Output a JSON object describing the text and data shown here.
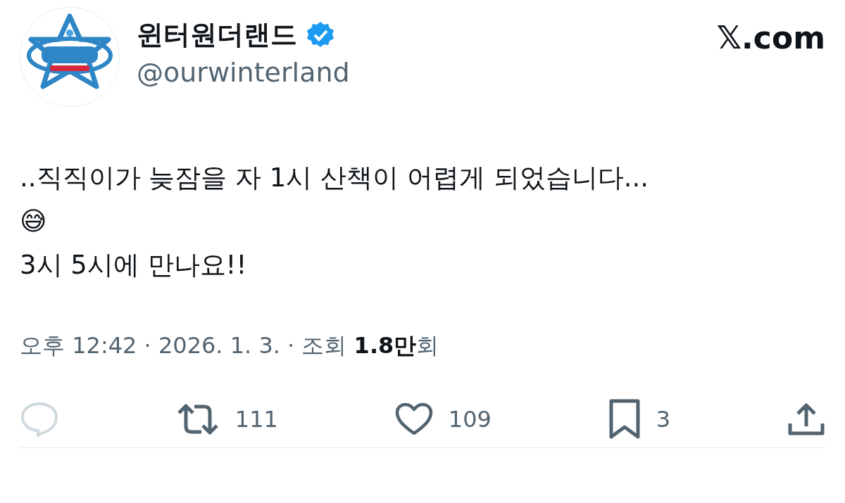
{
  "author": {
    "name": "윈터원더랜드",
    "verified": true,
    "handle": "@ourwinterland"
  },
  "site": "𝕏.com",
  "body": [
    "..직직이가 늦잠을 자 1시 산책이 어렵게 되었습니다...",
    "😅",
    "3시 5시에 만나요!!"
  ],
  "meta": "오후 12:42 · 2026. 1. 3. · 조회 **1.8만**회",
  "actions": [
    {
      "kind": "reply",
      "disabled": true
    },
    {
      "kind": "retweet",
      "count": "111",
      "disabled": false
    },
    {
      "kind": "like",
      "count": "109",
      "disabled": false
    },
    {
      "kind": "bookmark",
      "count": "3",
      "disabled": false
    },
    {
      "kind": "share",
      "disabled": false
    }
  ]
}
